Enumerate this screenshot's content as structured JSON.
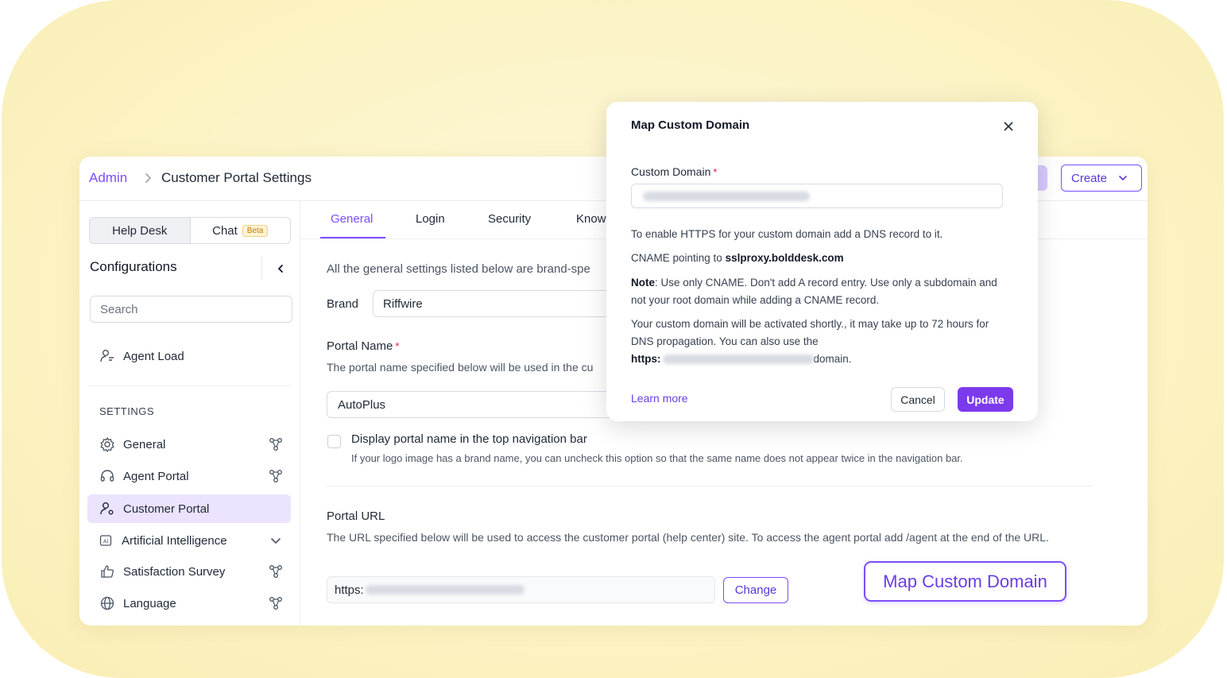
{
  "header": {
    "breadcrumb_root": "Admin",
    "page_title": "Customer Portal Settings",
    "create_label": "Create"
  },
  "sidebar": {
    "segments": [
      {
        "label": "Help Desk"
      },
      {
        "label": "Chat",
        "badge": "Beta"
      }
    ],
    "title": "Configurations",
    "search_placeholder": "Search",
    "pinned_item": {
      "label": "Agent Load",
      "icon": "agent-load-icon"
    },
    "section_label": "SETTINGS",
    "items": [
      {
        "label": "General",
        "icon": "gear-icon",
        "right_icon": "brand-specific-icon"
      },
      {
        "label": "Agent Portal",
        "icon": "headset-icon",
        "right_icon": "brand-specific-icon"
      },
      {
        "label": "Customer Portal",
        "icon": "user-settings-icon",
        "active": true
      },
      {
        "label": "Artificial Intelligence",
        "icon": "ai-icon",
        "right_icon": "chevron-down-icon"
      },
      {
        "label": "Satisfaction Survey",
        "icon": "thumbs-up-icon",
        "right_icon": "brand-specific-icon"
      },
      {
        "label": "Language",
        "icon": "globe-icon",
        "right_icon": "brand-specific-icon"
      }
    ]
  },
  "main": {
    "tabs": [
      {
        "label": "General",
        "active": true
      },
      {
        "label": "Login"
      },
      {
        "label": "Security"
      },
      {
        "label": "Know"
      }
    ],
    "description": "All the general settings listed below are brand-spe",
    "brand_label": "Brand",
    "brand_value": "Riffwire",
    "portal_name_label": "Portal Name",
    "portal_name_required": "*",
    "portal_name_help": "The portal name specified below will be used in the cu",
    "portal_name_value": "AutoPlus",
    "display_checkbox_label": "Display portal name in the top navigation bar",
    "display_checkbox_help": "If your logo image has a brand name, you can uncheck this option so that the same name does not appear twice in the navigation bar.",
    "portal_url_label": "Portal URL",
    "portal_url_help": "The URL specified below will be used to access the customer portal (help center) site. To access the agent portal add /agent at the end of the URL.",
    "portal_url_prefix": "https:",
    "change_label": "Change",
    "map_custom_domain_label": "Map Custom Domain"
  },
  "modal": {
    "title": "Map Custom Domain",
    "field_label": "Custom Domain",
    "field_required": "*",
    "line1": "To enable HTTPS for your custom domain add a DNS record to it.",
    "cname_prefix": "CNAME pointing to ",
    "cname_value": "sslproxy.bolddesk.com",
    "note_label": "Note",
    "note_text": ": Use only CNAME. Don't add A record entry. Use only a subdomain and not your root domain while adding a CNAME record.",
    "activation_text": "Your custom domain will be activated shortly., it may take up to 72 hours for DNS propagation. You can also use the",
    "https_label": "https:",
    "domain_suffix": "domain.",
    "learn_more": "Learn more",
    "cancel_label": "Cancel",
    "update_label": "Update"
  },
  "colors": {
    "accent": "#7c4dff",
    "backdrop": "#fcf3c4",
    "update_button": "#7c3aed"
  }
}
